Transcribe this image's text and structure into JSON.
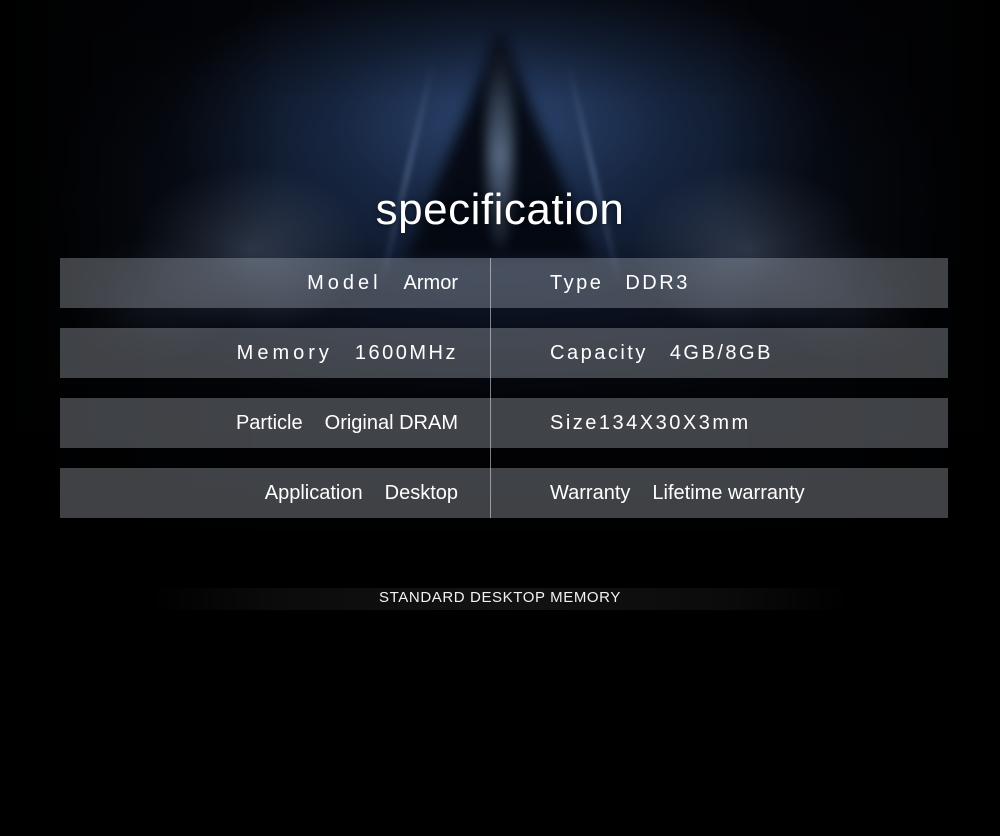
{
  "page": {
    "title": "specification",
    "background_color": "#000000",
    "accent_text_color": "#ffffff",
    "row_fill_color": "#bec4cd"
  },
  "spec_table": {
    "columns": 2,
    "rows": [
      {
        "left": {
          "label": "Model",
          "value": "Armor",
          "label_spaced": true,
          "value_spaced": false
        },
        "right": {
          "label": "Type",
          "value": "DDR3",
          "label_spaced": true,
          "value_spaced": true
        }
      },
      {
        "left": {
          "label": "Memory",
          "value": "1600MHz",
          "label_spaced": true,
          "value_spaced": true
        },
        "right": {
          "label": "Capacity",
          "value": "4GB/8GB",
          "label_spaced": true,
          "value_spaced": true
        }
      },
      {
        "left": {
          "label": "Particle",
          "value": "Original DRAM",
          "label_spaced": false,
          "value_spaced": false
        },
        "right": {
          "label": "Size134X30X3mm",
          "value": "",
          "label_spaced": true,
          "value_spaced": false
        }
      },
      {
        "left": {
          "label": "Application",
          "value": "Desktop",
          "label_spaced": false,
          "value_spaced": false
        },
        "right": {
          "label": "Warranty",
          "value": "Lifetime warranty",
          "label_spaced": false,
          "value_spaced": false
        }
      }
    ]
  },
  "footer": {
    "caption": "STANDARD DESKTOP MEMORY"
  }
}
